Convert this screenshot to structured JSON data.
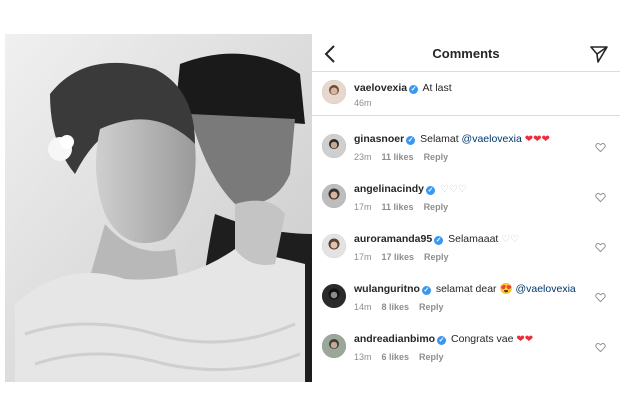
{
  "header": {
    "title": "Comments"
  },
  "caption": {
    "username": "vaelovexia",
    "text": "At last",
    "time": "46m"
  },
  "comments": [
    {
      "username": "ginasnoer",
      "verified": true,
      "text": "Selamat ",
      "mention": "@vaelovexia",
      "emoji": "❤❤❤",
      "time": "23m",
      "likes": "11 likes",
      "reply": "Reply"
    },
    {
      "username": "angelinacindy",
      "verified": true,
      "text": "",
      "mention": "",
      "emoji": "♡♡♡",
      "time": "17m",
      "likes": "11 likes",
      "reply": "Reply"
    },
    {
      "username": "auroramanda95",
      "verified": true,
      "text": "Selamaaat ",
      "mention": "",
      "emoji": "♡♡",
      "time": "17m",
      "likes": "17 likes",
      "reply": "Reply"
    },
    {
      "username": "wulanguritno",
      "verified": true,
      "text": "selamat dear ",
      "mention": "@vaelovexia",
      "emoji": "😍",
      "time": "14m",
      "likes": "8 likes",
      "reply": "Reply"
    },
    {
      "username": "andreadianbimo",
      "verified": true,
      "text": "Congrats vae ",
      "mention": "",
      "emoji": "❤❤",
      "time": "13m",
      "likes": "6 likes",
      "reply": "Reply"
    }
  ],
  "colors": {
    "verified": "#3897f0",
    "mention": "#00376b",
    "meta": "#8e8e8e",
    "heart": "#ed2c3c"
  },
  "icons": {
    "back": "chevron-left-icon",
    "send": "paper-plane-icon",
    "like": "heart-outline-icon"
  }
}
